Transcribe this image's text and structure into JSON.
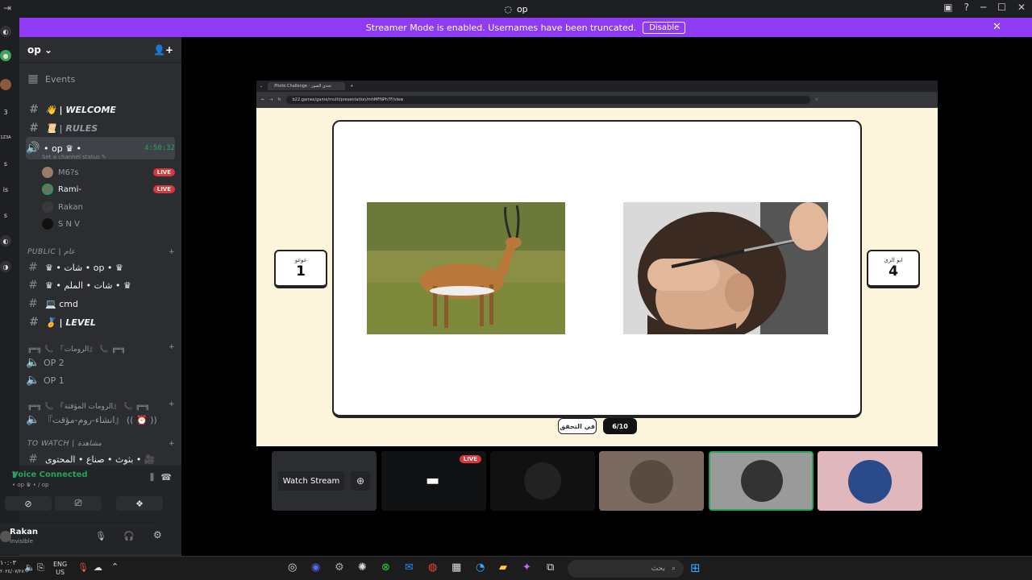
{
  "window": {
    "title": "op"
  },
  "banner": {
    "text": "Streamer Mode is enabled. Usernames have been truncated.",
    "disable_label": "Disable"
  },
  "left_strip": {
    "labels": [
      "3",
      "1Z3A",
      "s",
      "is",
      "s"
    ]
  },
  "server": {
    "name": "op"
  },
  "sidebar": {
    "events_label": "Events",
    "channels_top": [
      {
        "label": "👋 | WELCOME"
      },
      {
        "label": "📜 | RULES"
      }
    ],
    "voice_channel": {
      "label": "• op ♛ •",
      "timer": "4:50:32",
      "status": "Set a channel status"
    },
    "members": [
      {
        "name": "M6?s",
        "live": "LIVE"
      },
      {
        "name": "Rami-",
        "live": "LIVE"
      },
      {
        "name": "Rakan",
        "live": ""
      },
      {
        "name": "S N V",
        "live": ""
      }
    ],
    "category_public": "PUBLIC | عام",
    "public_channels": [
      {
        "label": "♛ • شات • op • ♛"
      },
      {
        "label": "♛ • شات • الملم • ♛"
      },
      {
        "label": "💻 cmd"
      },
      {
        "label": "🏅 | LEVEL"
      }
    ],
    "category_rooms1": "╔═╗ 📞 『الرومات』 📞 ╔═╗",
    "rooms1": [
      {
        "label": "OP 2"
      },
      {
        "label": "OP 1"
      }
    ],
    "category_rooms2": "╔═╗ 📞 『الرومات المؤقتة』 📞 ╔═╗",
    "rooms2": [
      {
        "label": "『انشاء-روم-مؤقت』 (( ⏰ ))"
      }
    ],
    "category_watch": "TO WATCH | مشاهدة",
    "watch_channels": [
      {
        "label": "بثوث • صناع • المحتوى • 🎥"
      }
    ]
  },
  "voice_panel": {
    "status": "Voice Connected",
    "sub": "• op ♛ • / op",
    "user_name": "Rakan",
    "user_status": "Invisible"
  },
  "stream": {
    "browser_tab": "Photo Challenge - تحدي الصور",
    "url": "b22.games/game/multi/presentation/mhMFNPh7F/view",
    "left_score": {
      "name": "غوغو",
      "points": "1"
    },
    "right_score": {
      "name": "ابو الري",
      "points": "4"
    },
    "plus": "+",
    "pill_left": "في التحقق",
    "pill_right": "6/10"
  },
  "tiles": {
    "watch_label": "Watch Stream",
    "live_label": "LIVE"
  },
  "taskbar": {
    "time": "١٠:٠٣",
    "date": "٢٠٢٤/٠٧/٢٨",
    "lang1": "ENG",
    "lang2": "US",
    "search_placeholder": "بحث"
  }
}
